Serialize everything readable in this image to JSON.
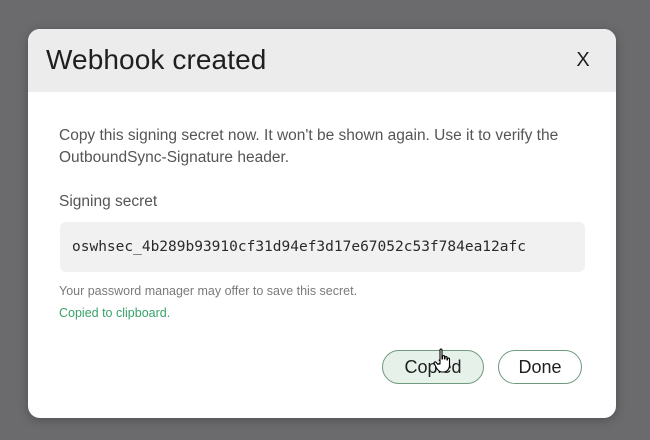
{
  "dialog": {
    "title": "Webhook created",
    "close_label": "X",
    "description": "Copy this signing secret now. It won't be shown again. Use it to verify the OutboundSync-Signature header.",
    "field_label": "Signing secret",
    "secret_value": "oswhsec_4b289b93910cf31d94ef3d17e67052c53f784ea12afc",
    "hint": "Your password manager may offer to save this secret.",
    "status": "Copied to clipboard.",
    "copy_button_label": "Copied",
    "done_button_label": "Done"
  },
  "colors": {
    "overlay": "#6b6b6d",
    "header_bg": "#ececec",
    "status_green": "#3aa36b",
    "button_border": "#6f9a7f",
    "copied_button_bg": "#e6f1ea"
  },
  "icons": {
    "cursor": "hand-pointer-icon"
  }
}
